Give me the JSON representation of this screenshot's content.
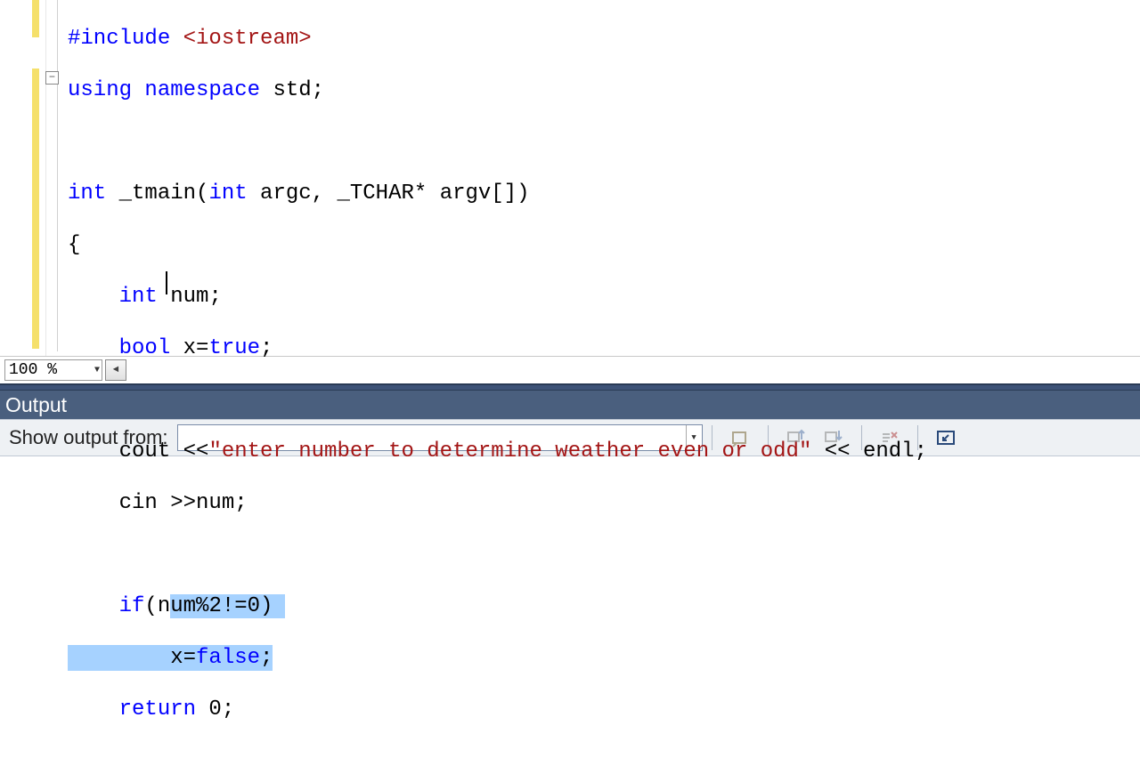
{
  "code": {
    "line1": {
      "kw": "#include",
      "rest": " <iostream>"
    },
    "line2": {
      "kw1": "using",
      "kw2": "namespace",
      "rest": " std;"
    },
    "line4": {
      "int": "int",
      "name": " _tmain(",
      "int2": "int",
      "args": " argc, _TCHAR* argv[])"
    },
    "line5": "{",
    "line6": {
      "int": "int",
      "rest": " num;"
    },
    "line7": {
      "bool": "bool",
      "mid": " x=",
      "true": "true",
      "semi": ";"
    },
    "line9": {
      "cout": "    cout <<",
      "str": "\"enter number to determine weather even or odd\"",
      "endl": " << endl;"
    },
    "line10": "    cin >>num;",
    "line12": {
      "pre": "    ",
      "if": "if",
      "open": "(n",
      "sel": "um%2!=0)"
    },
    "line13": {
      "indent_sel": "        x=",
      "false": "false",
      "semi": ";"
    },
    "line14": {
      "ret": "return",
      "rest": " 0;"
    }
  },
  "zoom": "100 %",
  "outline_symbol": "−",
  "output": {
    "title": "Output",
    "label": "Show output from:",
    "combo_value": ""
  }
}
